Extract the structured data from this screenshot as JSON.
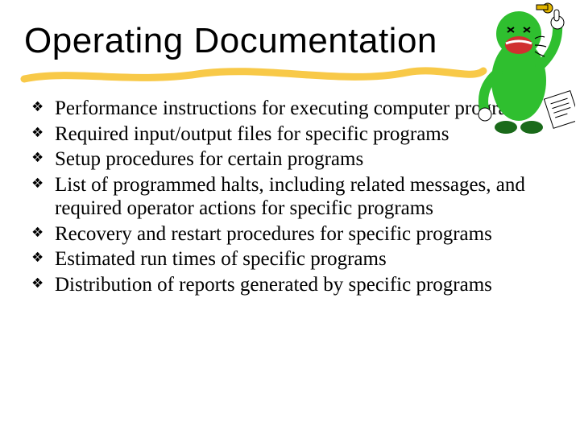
{
  "title": "Operating Documentation",
  "underline_color": "#f8c948",
  "bullets": [
    "Performance instructions for executing computer programs",
    "Required input/output files for specific programs",
    "Setup procedures for certain programs",
    "List of programmed halts, including related messages, and required operator actions for specific programs",
    "Recovery and restart procedures for specific programs",
    "Estimated run times of specific programs",
    "Distribution of reports generated by specific programs"
  ],
  "bullet_glyph": "❖",
  "character": {
    "alt": "cartoon-green-figure-shouting",
    "body_color": "#2fbf2f",
    "mouth_color": "#d03030",
    "whistle_color": "#e2b500",
    "paper_color": "#ffffff"
  }
}
